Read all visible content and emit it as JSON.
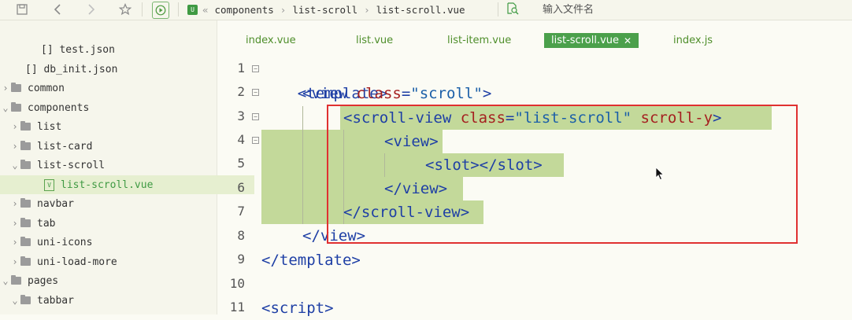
{
  "toolbar": {
    "save_icon": "save-icon",
    "back_icon": "chevron-left-icon",
    "forward_icon": "chevron-right-icon",
    "favorite_icon": "star-icon",
    "run_icon": "play-icon"
  },
  "breadcrumb": {
    "badge": "U",
    "back": "«",
    "items": [
      "components",
      "list-scroll",
      "list-scroll.vue"
    ]
  },
  "search": {
    "placeholder": "输入文件名"
  },
  "sidebar": {
    "items": [
      {
        "label": "[] test.json"
      },
      {
        "label": "[] db_init.json"
      },
      {
        "label": "common"
      },
      {
        "label": "components"
      },
      {
        "label": "list"
      },
      {
        "label": "list-card"
      },
      {
        "label": "list-scroll"
      },
      {
        "label": "list-scroll.vue"
      },
      {
        "label": "navbar"
      },
      {
        "label": "tab"
      },
      {
        "label": "uni-icons"
      },
      {
        "label": "uni-load-more"
      },
      {
        "label": "pages"
      },
      {
        "label": "tabbar"
      }
    ]
  },
  "tabs": [
    {
      "label": "index.vue"
    },
    {
      "label": "list.vue"
    },
    {
      "label": "list-item.vue"
    },
    {
      "label": "list-scroll.vue",
      "active": true
    },
    {
      "label": "index.js"
    }
  ],
  "editor": {
    "line_numbers": [
      "1",
      "2",
      "3",
      "4",
      "5",
      "6",
      "7",
      "8",
      "9",
      "10",
      "11"
    ],
    "l1": {
      "tag": "<template>"
    },
    "l2": {
      "tag1": "<view ",
      "attr": "class",
      "eq": "=",
      "val": "\"scroll\"",
      "tag2": ">"
    },
    "l3": {
      "tag1": "<scroll-view ",
      "attr1": "class",
      "eq": "=",
      "val": "\"list-scroll\"",
      "attr2": " scroll-y",
      "tag2": ">"
    },
    "l4": {
      "tag": "<view>"
    },
    "l5": {
      "tag": "<slot></slot>"
    },
    "l6": {
      "tag": "</view>"
    },
    "l7": {
      "tag": "</scroll-view>"
    },
    "l8": {
      "tag": "</view>"
    },
    "l9": {
      "tag": "</template>"
    },
    "l11": {
      "tag": "<script>"
    }
  },
  "colors": {
    "accent": "#4ba04b",
    "selection": "#c3d99a",
    "highlight_box": "#e03131",
    "tag": "#1e3fa5",
    "attr": "#a52020"
  }
}
